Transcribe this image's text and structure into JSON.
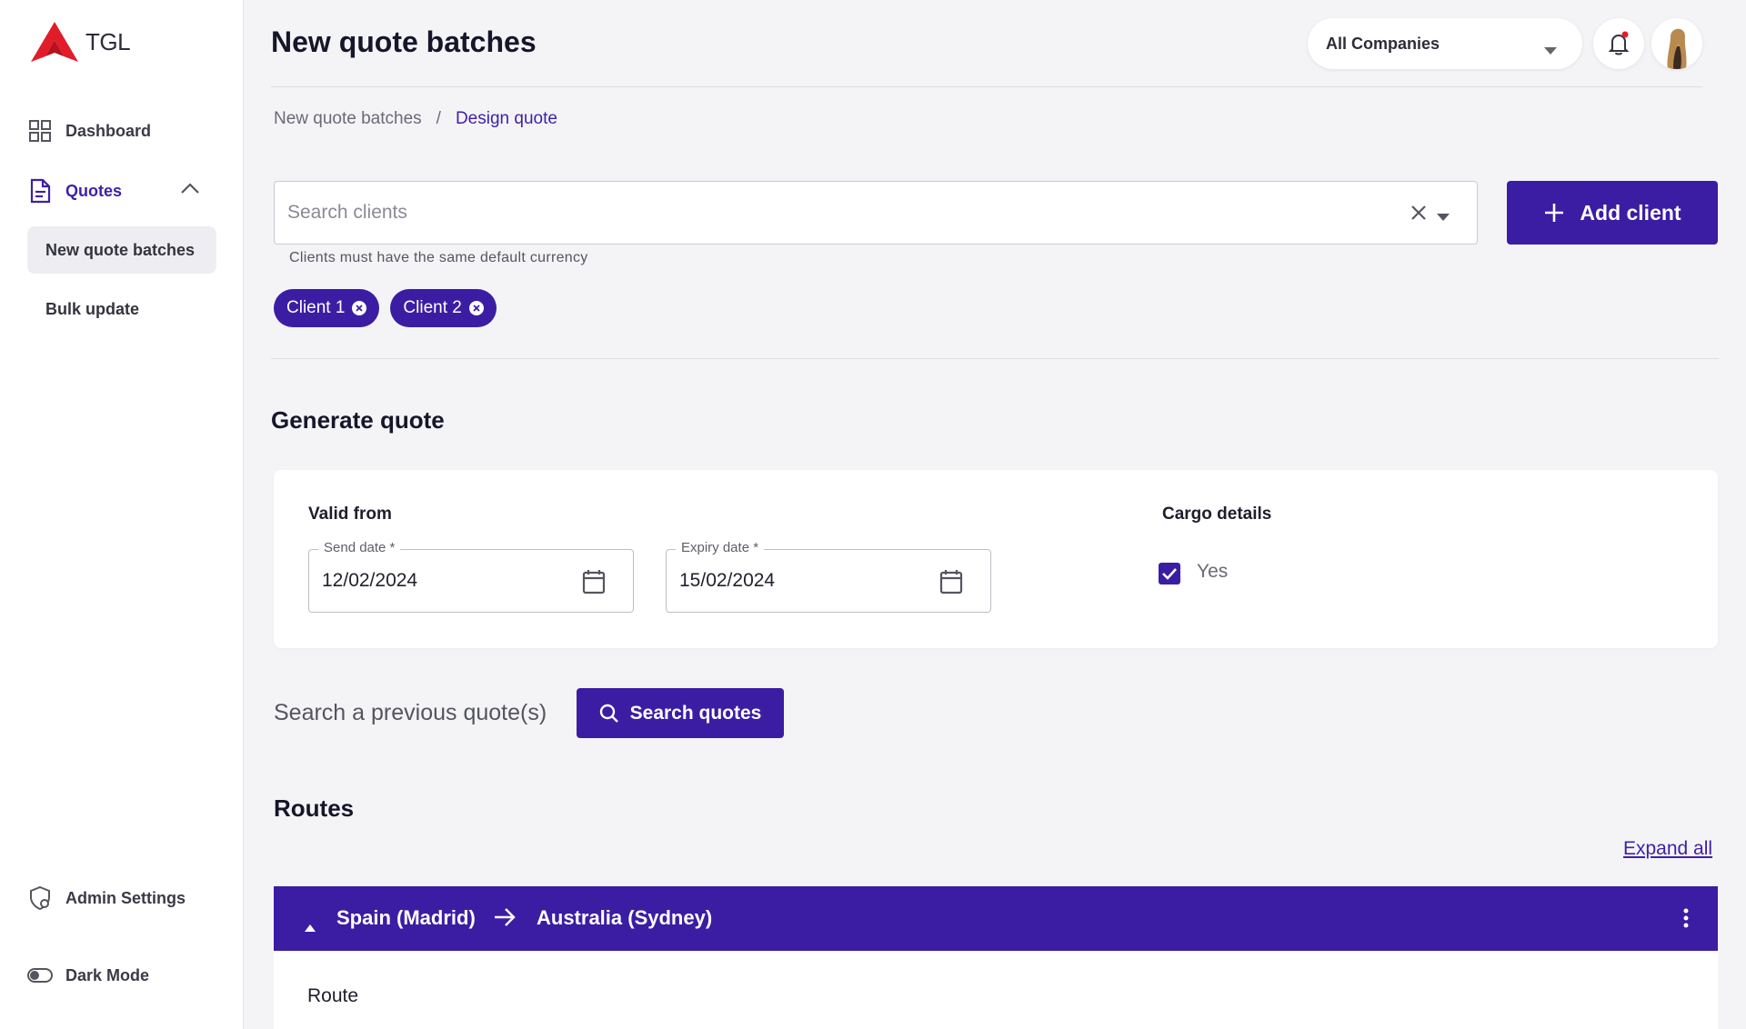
{
  "brand": {
    "name": "TGL",
    "accent": "#3b1da3",
    "logo_color": "#e11d2a"
  },
  "sidebar": {
    "items": [
      {
        "label": "Dashboard",
        "icon": "dashboard-grid-icon"
      },
      {
        "label": "Quotes",
        "icon": "document-icon",
        "expanded": true
      }
    ],
    "sub_items": [
      {
        "label": "New quote batches",
        "selected": true
      },
      {
        "label": "Bulk update",
        "selected": false
      }
    ],
    "bottom_items": [
      {
        "label": "Admin Settings",
        "icon": "shield-settings-icon"
      },
      {
        "label": "Dark Mode",
        "icon": "toggle-icon"
      }
    ]
  },
  "header": {
    "title": "New quote batches",
    "company_select": {
      "value": "All Companies"
    },
    "notifications": {
      "has_unread": true
    }
  },
  "breadcrumb": {
    "parent": "New quote batches",
    "separator": "/",
    "current": "Design quote"
  },
  "clients": {
    "search_placeholder": "Search clients",
    "helper": "Clients must have the same default currency",
    "add_label": "Add client",
    "chips": [
      "Client 1",
      "Client 2"
    ]
  },
  "generate": {
    "title": "Generate quote",
    "valid_from_label": "Valid from",
    "send_date": {
      "legend": "Send date *",
      "value": "12/02/2024"
    },
    "expiry_date": {
      "legend": "Expiry date *",
      "value": "15/02/2024"
    },
    "cargo_label": "Cargo details",
    "cargo_checkbox": {
      "label": "Yes",
      "checked": true
    }
  },
  "previous": {
    "label": "Search a previous quote(s)",
    "button": "Search quotes"
  },
  "routes": {
    "title": "Routes",
    "expand_all": "Expand all",
    "items": [
      {
        "from": "Spain (Madrid)",
        "to": "Australia (Sydney)",
        "body_label": "Route"
      }
    ]
  }
}
